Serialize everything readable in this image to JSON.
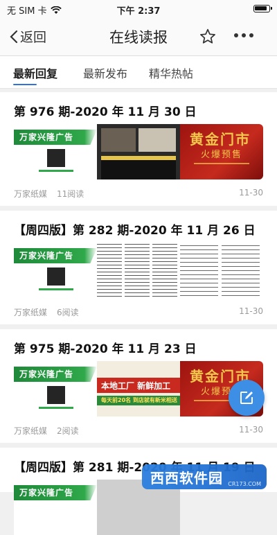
{
  "status_bar": {
    "carrier": "无 SIM 卡",
    "time": "下午 2:37"
  },
  "nav": {
    "back_label": "返回",
    "title": "在线读报"
  },
  "tabs": [
    {
      "label": "最新回复",
      "active": true
    },
    {
      "label": "最新发布",
      "active": false
    },
    {
      "label": "精华热帖",
      "active": false
    }
  ],
  "ad_banner_text": "万家兴隆广告",
  "items": [
    {
      "title": "第 976 期-2020 年 11 月 30 日",
      "source": "万家纸媒",
      "reads": "11阅读",
      "date": "11-30",
      "gold_title": "黄金门市",
      "gold_sub": "火爆预售"
    },
    {
      "title": "【周四版】第 282 期-2020 年 11 月 26 日",
      "source": "万家纸媒",
      "reads": "6阅读",
      "date": "11-30"
    },
    {
      "title": "第 975 期-2020 年 11 月 23 日",
      "source": "万家纸媒",
      "reads": "2阅读",
      "date": "11-30",
      "promo_title": "本地工厂 新鲜加工",
      "promo_sub": "每天前20名 到店就有新米相送",
      "gold_title": "黄金门市",
      "gold_sub": "火爆预售"
    },
    {
      "title": "【周四版】第 281 期-2020 年 11 月 19 日"
    }
  ],
  "watermark": {
    "text": "西西软件园",
    "url": "CR173.COM"
  },
  "colors": {
    "accent": "#2f73d8",
    "fab": "#3d8fe6",
    "ad_green": "#2fa84a",
    "promo_red": "#c62a1e"
  }
}
